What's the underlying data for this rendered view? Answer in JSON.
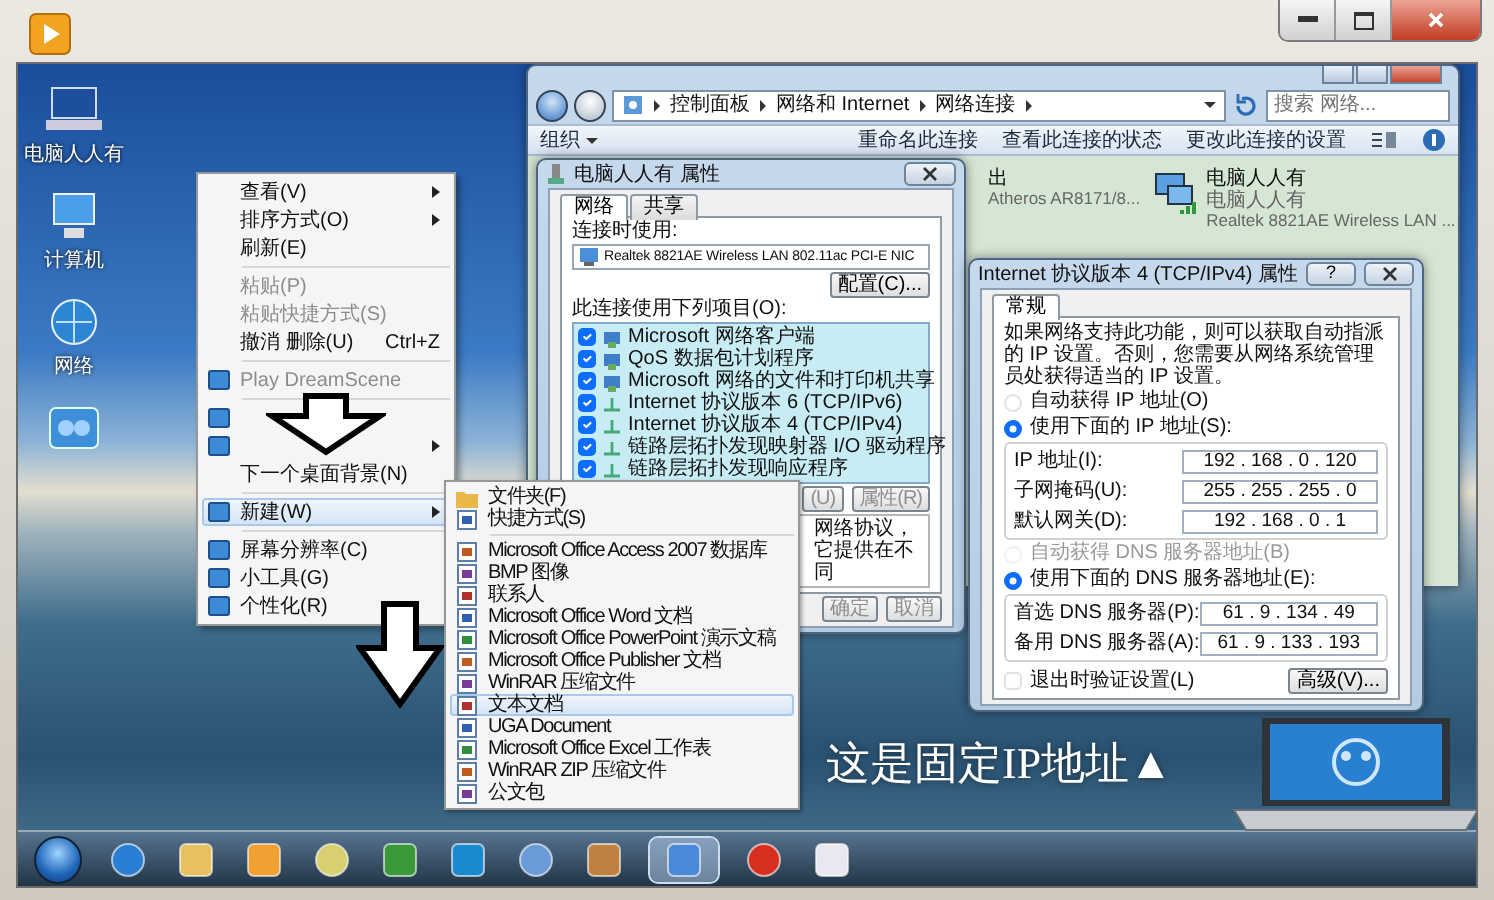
{
  "desktop_icons": [
    {
      "label": "电脑人人有"
    },
    {
      "label": "计算机"
    },
    {
      "label": "网络"
    }
  ],
  "explorer": {
    "breadcrumb": [
      "控制面板",
      "网络和 Internet",
      "网络连接"
    ],
    "search": {
      "placeholder": "搜索 网络..."
    },
    "toolbar": [
      {
        "label": "组织",
        "dropdown": true
      },
      {
        "label": "重命名此连接",
        "dropdown": false
      },
      {
        "label": "查看此连接的状态",
        "dropdown": false
      },
      {
        "label": "更改此连接的设置",
        "dropdown": false
      }
    ],
    "connections": [
      {
        "kind": "partial",
        "lines": [
          "出",
          "Atheros AR8171/8..."
        ]
      },
      {
        "kind": "adapter",
        "lines": [
          "电脑人人有",
          "电脑人人有",
          "Realtek 8821AE Wireless LAN ..."
        ]
      }
    ]
  },
  "properties_dialog": {
    "title": "电脑人人有 属性",
    "tabs": [
      {
        "label": "网络",
        "selected": true
      },
      {
        "label": "共享",
        "selected": false
      }
    ],
    "connect_using_label": "连接时使用:",
    "adapter": "Realtek 8821AE Wireless LAN 802.11ac PCI-E NIC",
    "configure_button": "配置(C)...",
    "items_label": "此连接使用下列项目(O):",
    "items": [
      {
        "label": "Microsoft 网络客户端",
        "checked": true
      },
      {
        "label": "QoS 数据包计划程序",
        "checked": true
      },
      {
        "label": "Microsoft 网络的文件和打印机共享",
        "checked": true
      },
      {
        "label": "Internet 协议版本 6 (TCP/IPv6)",
        "checked": true
      },
      {
        "label": "Internet 协议版本 4 (TCP/IPv4)",
        "checked": true
      },
      {
        "label": "链路层拓扑发现映射器 I/O 驱动程序",
        "checked": true
      },
      {
        "label": "链路层拓扑发现响应程序",
        "checked": true
      }
    ],
    "item_buttons": [
      "(U)",
      "属性(R)"
    ],
    "description": "网络协议，它提供在不同",
    "buttons": [
      "确定",
      "取消"
    ]
  },
  "tcp_dialog": {
    "title": "Internet 协议版本 4 (TCP/IPv4) 属性",
    "help_button": "?",
    "tabs": [
      {
        "label": "常规",
        "selected": true
      }
    ],
    "intro": "如果网络支持此功能，则可以获取自动指派的 IP 设置。否则，您需要从网络系统管理员处获得适当的 IP 设置。",
    "ip_mode": [
      {
        "label": "自动获得 IP 地址(O)",
        "selected": false,
        "disabled": false
      },
      {
        "label": "使用下面的 IP 地址(S):",
        "selected": true,
        "disabled": false
      }
    ],
    "ip_fields": [
      {
        "label": "IP 地址(I):",
        "value": "192 . 168 . 0 . 120"
      },
      {
        "label": "子网掩码(U):",
        "value": "255 . 255 . 255 . 0"
      },
      {
        "label": "默认网关(D):",
        "value": "192 . 168 . 0 . 1"
      }
    ],
    "dns_mode": [
      {
        "label": "自动获得 DNS 服务器地址(B)",
        "selected": false,
        "disabled": true
      },
      {
        "label": "使用下面的 DNS 服务器地址(E):",
        "selected": true,
        "disabled": false
      }
    ],
    "dns_fields": [
      {
        "label": "首选 DNS 服务器(P):",
        "value": "61 . 9 . 134 . 49"
      },
      {
        "label": "备用 DNS 服务器(A):",
        "value": "61 . 9 . 133 . 193"
      }
    ],
    "validate": {
      "label": "退出时验证设置(L)",
      "checked": false
    },
    "advanced_button": "高级(V)..."
  },
  "context_menu": [
    {
      "kind": "item",
      "label": "查看(V)",
      "submenu": true,
      "disabled": false,
      "selected": false
    },
    {
      "kind": "item",
      "label": "排序方式(O)",
      "submenu": true,
      "disabled": false,
      "selected": false
    },
    {
      "kind": "item",
      "label": "刷新(E)",
      "submenu": false,
      "disabled": false,
      "selected": false
    },
    {
      "kind": "separator"
    },
    {
      "kind": "item",
      "label": "粘贴(P)",
      "submenu": false,
      "disabled": true,
      "selected": false
    },
    {
      "kind": "item",
      "label": "粘贴快捷方式(S)",
      "submenu": false,
      "disabled": true,
      "selected": false
    },
    {
      "kind": "item",
      "label": "撤消 删除(U)",
      "shortcut": "Ctrl+Z",
      "submenu": false,
      "disabled": false,
      "selected": false
    },
    {
      "kind": "separator"
    },
    {
      "kind": "item",
      "label": "Play DreamScene",
      "submenu": false,
      "disabled": true,
      "selected": false
    },
    {
      "kind": "separator"
    },
    {
      "kind": "icon_only",
      "submenu": false
    },
    {
      "kind": "icon_only",
      "submenu": true
    },
    {
      "kind": "item",
      "label": "下一个桌面背景(N)",
      "submenu": false,
      "disabled": false,
      "selected": false
    },
    {
      "kind": "separator"
    },
    {
      "kind": "item",
      "label": "新建(W)",
      "submenu": true,
      "disabled": false,
      "selected": true
    },
    {
      "kind": "separator"
    },
    {
      "kind": "item",
      "label": "屏幕分辨率(C)",
      "submenu": false,
      "disabled": false,
      "selected": false
    },
    {
      "kind": "item",
      "label": "小工具(G)",
      "submenu": false,
      "disabled": false,
      "selected": false
    },
    {
      "kind": "item",
      "label": "个性化(R)",
      "submenu": false,
      "disabled": false,
      "selected": false
    }
  ],
  "new_submenu": [
    {
      "kind": "item",
      "label": "文件夹(F)",
      "selected": false
    },
    {
      "kind": "item",
      "label": "快捷方式(S)",
      "selected": false
    },
    {
      "kind": "separator"
    },
    {
      "kind": "item",
      "label": "Microsoft Office Access 2007 数据库",
      "selected": false
    },
    {
      "kind": "item",
      "label": "BMP 图像",
      "selected": false
    },
    {
      "kind": "item",
      "label": "联系人",
      "selected": false
    },
    {
      "kind": "item",
      "label": "Microsoft Office Word 文档",
      "selected": false
    },
    {
      "kind": "item",
      "label": "Microsoft Office PowerPoint 演示文稿",
      "selected": false
    },
    {
      "kind": "item",
      "label": "Microsoft Office Publisher 文档",
      "selected": false
    },
    {
      "kind": "item",
      "label": "WinRAR 压缩文件",
      "selected": false
    },
    {
      "kind": "item",
      "label": "文本文档",
      "selected": true
    },
    {
      "kind": "item",
      "label": "UGA Document",
      "selected": false
    },
    {
      "kind": "item",
      "label": "Microsoft Office Excel 工作表",
      "selected": false
    },
    {
      "kind": "item",
      "label": "WinRAR ZIP 压缩文件",
      "selected": false
    },
    {
      "kind": "item",
      "label": "公文包",
      "selected": false
    }
  ],
  "annotation": {
    "text": "这是固定IP地址▲"
  },
  "taskbar": {
    "apps": [
      {
        "selected": false
      },
      {
        "selected": false
      },
      {
        "selected": false
      },
      {
        "selected": false
      },
      {
        "selected": false
      },
      {
        "selected": false
      },
      {
        "selected": false
      },
      {
        "selected": false
      },
      {
        "selected": true
      },
      {
        "selected": false
      },
      {
        "selected": false
      }
    ]
  }
}
